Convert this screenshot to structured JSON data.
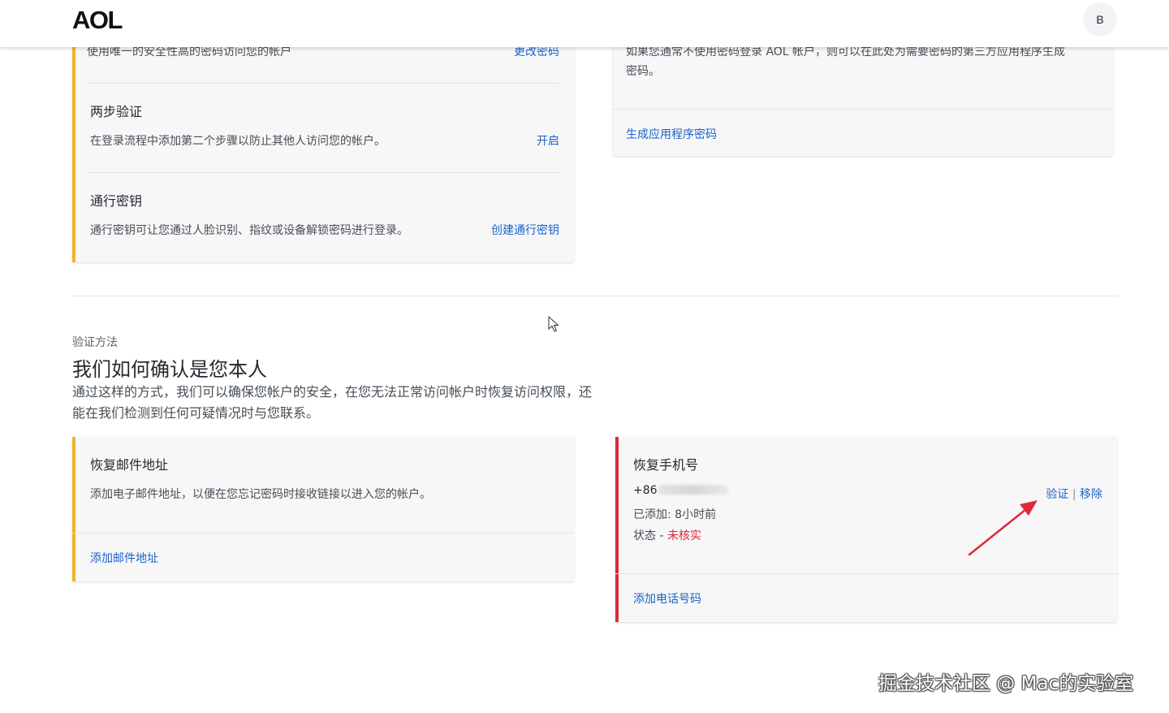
{
  "header": {
    "logo": "AOL",
    "avatar_initial": "B"
  },
  "security_card": {
    "partial_desc": "使用唯一的安全性高的密码访问您的帐户",
    "change_password_link": "更改密码",
    "two_step": {
      "title": "两步验证",
      "desc": "在登录流程中添加第二个步骤以防止其他人访问您的帐户。",
      "action": "开启"
    },
    "passkey": {
      "title": "通行密钥",
      "desc": "通行密钥可让您通过人脸识别、指纹或设备解锁密码进行登录。",
      "action": "创建通行密钥"
    }
  },
  "app_password_card": {
    "desc_line1": "如果您通常不使用密码登录 AOL 帐户，则可以在此处为需要密码的第三方应用程序生成",
    "desc_line2": "密码。",
    "action": "生成应用程序密码"
  },
  "verification": {
    "eyebrow": "验证方法",
    "heading": "我们如何确认是您本人",
    "intro": "通过这样的方式，我们可以确保您帐户的安全，在您无法正常访问帐户时恢复访问权限，还能在我们检测到任何可疑情况时与您联系。"
  },
  "recovery_email": {
    "title": "恢复邮件地址",
    "desc": "添加电子邮件地址，以便在您忘记密码时接收链接以进入您的帐户。",
    "action": "添加邮件地址"
  },
  "recovery_phone": {
    "title": "恢复手机号",
    "phone_prefix": "+86",
    "added": "已添加: 8小时前",
    "status_label": "状态 - ",
    "status_value": "未核实",
    "verify_link": "验证",
    "divider": "|",
    "remove_link": "移除",
    "action": "添加电话号码"
  },
  "watermark": "掘金技术社区 @ Mac的实验室",
  "colors": {
    "accent_amber": "#f0b22d",
    "accent_red": "#e0283a",
    "link_blue": "#1a63c9"
  },
  "icons": {
    "cursor": "mouse-pointer-icon",
    "annotation": "red-arrow-annotation"
  }
}
